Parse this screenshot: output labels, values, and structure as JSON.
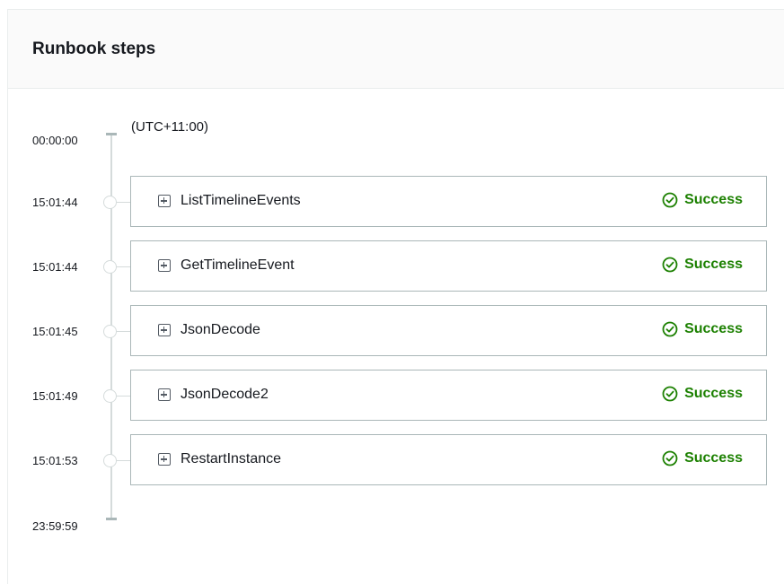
{
  "panel": {
    "title": "Runbook steps"
  },
  "timeline": {
    "start_time": "00:00:00",
    "end_time": "23:59:59",
    "timezone": "(UTC+11:00)"
  },
  "steps": [
    {
      "time": "15:01:44",
      "name": "ListTimelineEvents",
      "status": "Success"
    },
    {
      "time": "15:01:44",
      "name": "GetTimelineEvent",
      "status": "Success"
    },
    {
      "time": "15:01:45",
      "name": "JsonDecode",
      "status": "Success"
    },
    {
      "time": "15:01:49",
      "name": "JsonDecode2",
      "status": "Success"
    },
    {
      "time": "15:01:53",
      "name": "RestartInstance",
      "status": "Success"
    }
  ],
  "colors": {
    "success": "#1d8102",
    "border": "#aab7b8",
    "header_bg": "#fafafa"
  },
  "icons": {
    "expand": "plus-square-icon",
    "status": "check-circle-icon"
  }
}
